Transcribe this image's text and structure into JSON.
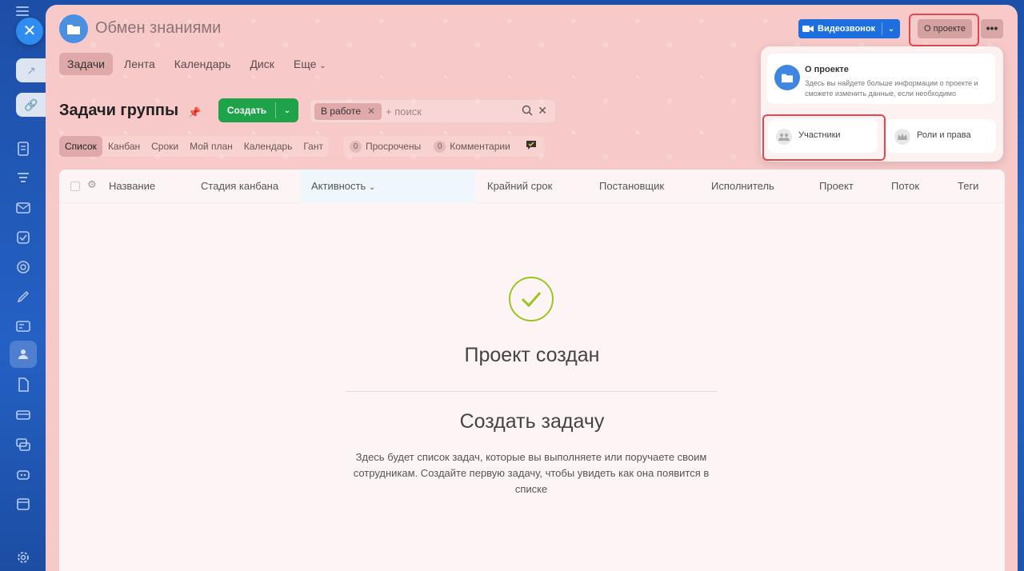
{
  "project": {
    "title": "Обмен знаниями"
  },
  "top_tabs": [
    {
      "label": "Задачи"
    },
    {
      "label": "Лента"
    },
    {
      "label": "Календарь"
    },
    {
      "label": "Диск"
    },
    {
      "label": "Еще"
    }
  ],
  "header": {
    "video_label": "Видеозвонок",
    "about_label": "О проекте",
    "more_label": "•••"
  },
  "popup": {
    "about_title": "О проекте",
    "about_desc": "Здесь вы найдете больше информации о проекте и сможете изменить данные, если необходимо",
    "members_label": "Участники",
    "roles_label": "Роли и права"
  },
  "page": {
    "heading": "Задачи группы",
    "create_label": "Создать",
    "filter_chip": "В работе",
    "search_placeholder": "+ поиск"
  },
  "view_tabs": [
    {
      "label": "Список"
    },
    {
      "label": "Канбан"
    },
    {
      "label": "Сроки"
    },
    {
      "label": "Мой план"
    },
    {
      "label": "Календарь"
    },
    {
      "label": "Гант"
    }
  ],
  "counters": [
    {
      "count": "0",
      "label": "Просрочены"
    },
    {
      "count": "0",
      "label": "Комментарии"
    }
  ],
  "columns": [
    "Название",
    "Стадия канбана",
    "Активность",
    "Крайний срок",
    "Постановщик",
    "Исполнитель",
    "Проект",
    "Поток",
    "Теги"
  ],
  "empty": {
    "title": "Проект создан",
    "subtitle": "Создать задачу",
    "description": "Здесь будет список задач, которые вы выполняете или поручаете своим сотрудникам. Создайте первую задачу, чтобы увидеть как она появится в списке"
  },
  "colors": {
    "accent": "#1d6fe0",
    "create": "#1ea34a",
    "highlight_frame": "#e2484e",
    "panel_bg": "#f7c9c9",
    "check": "#9cc421"
  }
}
